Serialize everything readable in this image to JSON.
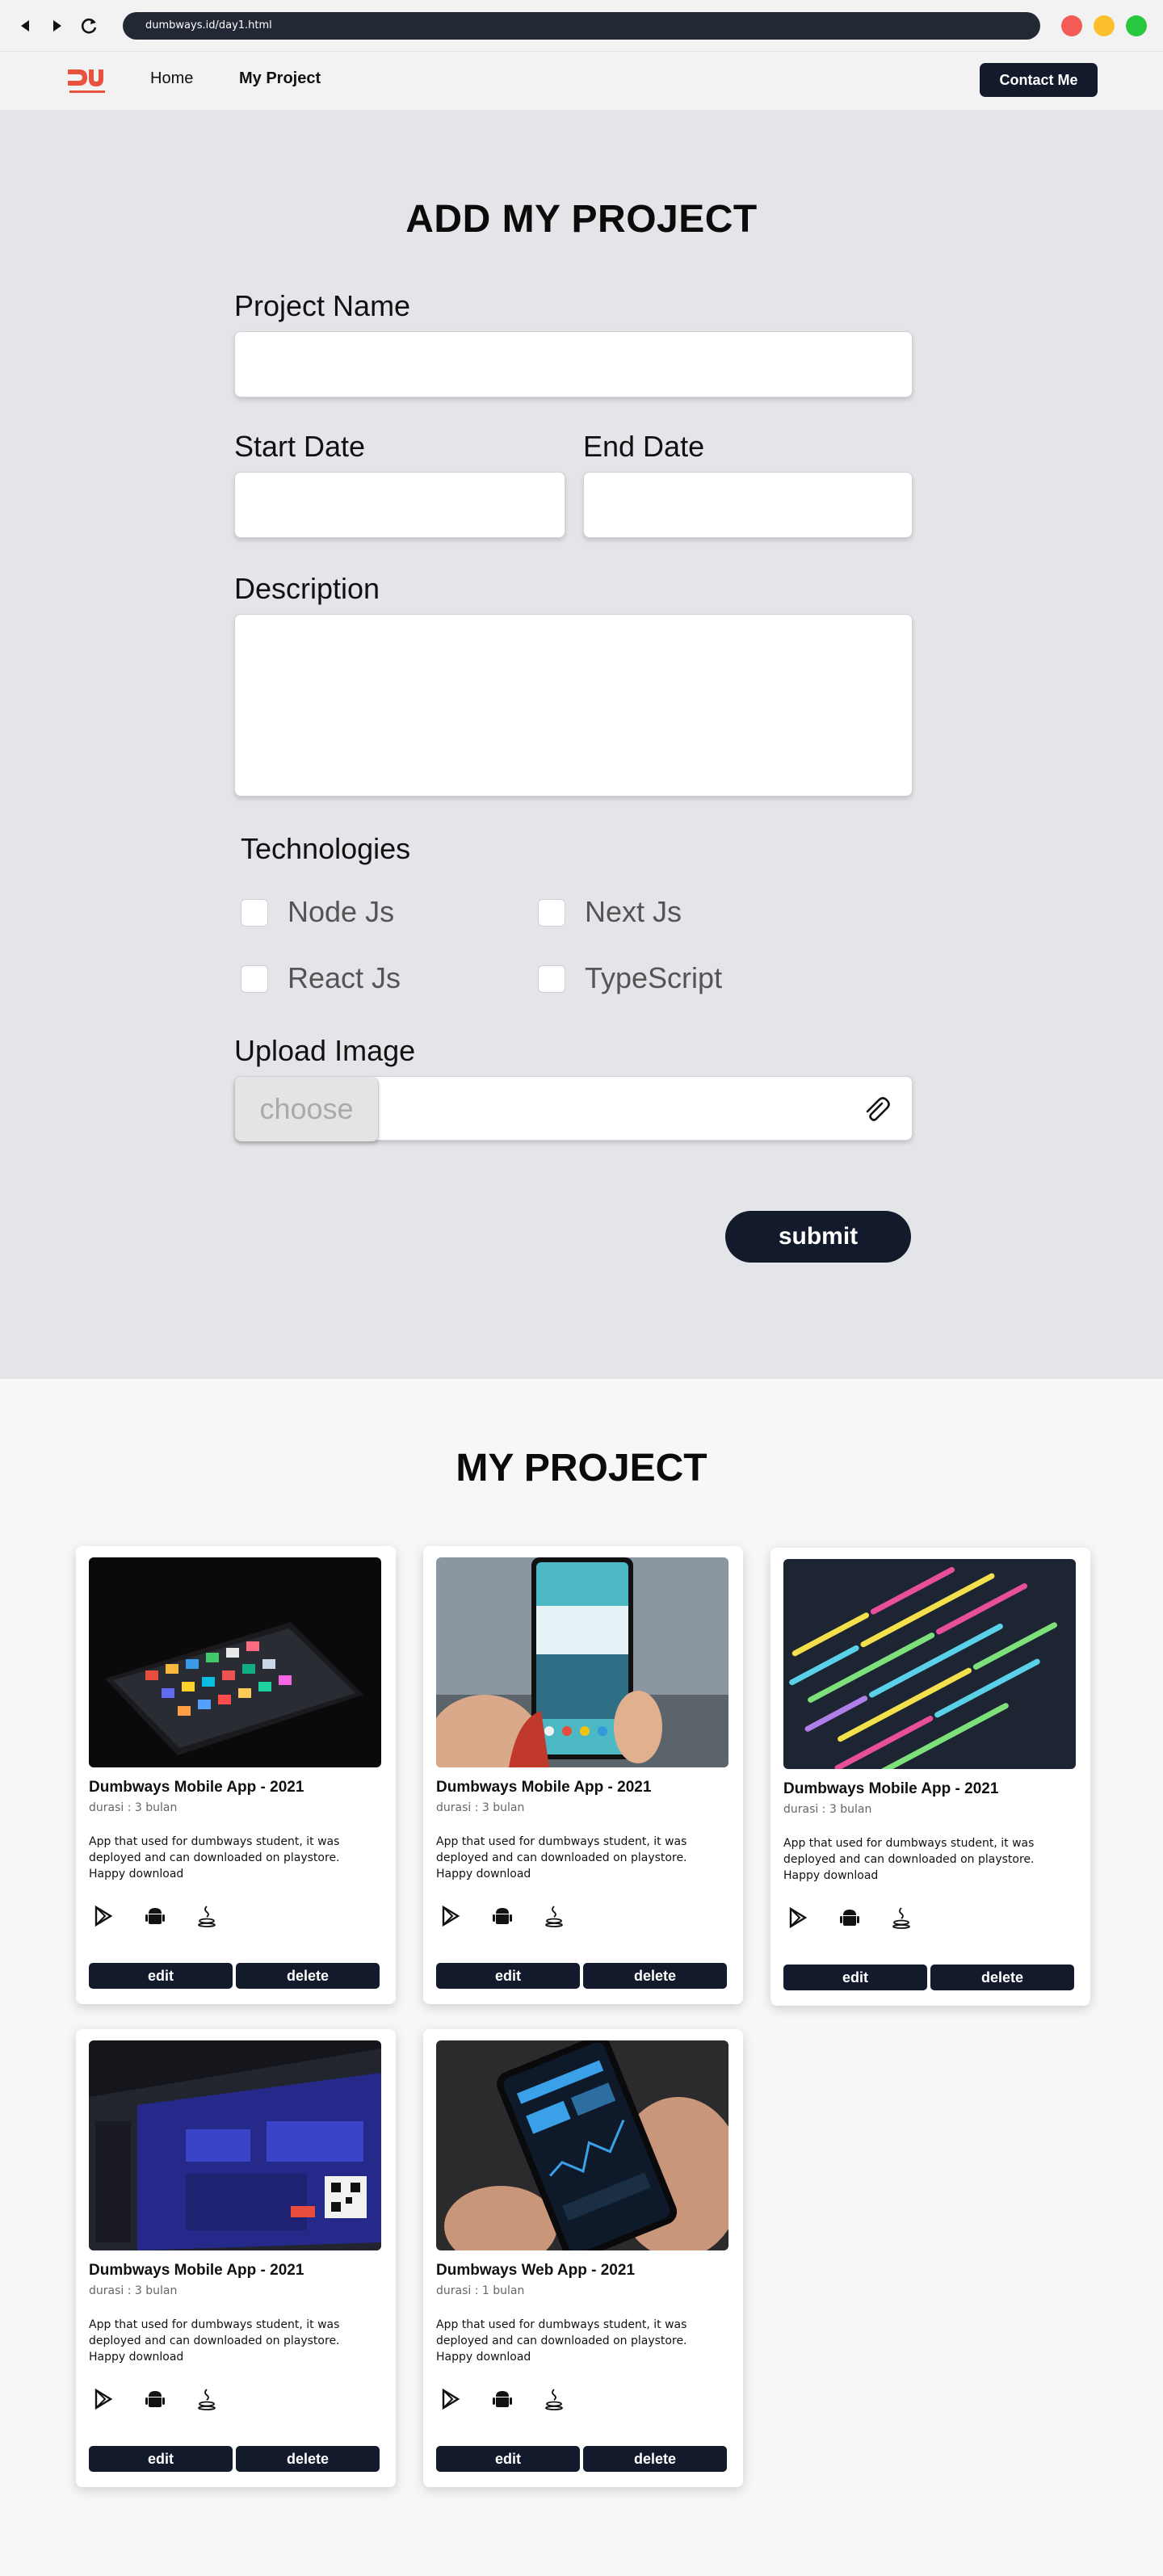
{
  "browser": {
    "url": "dumbways.id/day1.html",
    "dot_colors": [
      "#f25b56",
      "#fbbf2e",
      "#27c840"
    ]
  },
  "nav": {
    "logo_icon": "dumbways-logo",
    "links": [
      {
        "label": "Home"
      },
      {
        "label": "My Project"
      }
    ],
    "contact_label": "Contact Me"
  },
  "form": {
    "title": "ADD MY PROJECT",
    "project_name_label": "Project Name",
    "project_name_value": "",
    "start_date_label": "Start Date",
    "start_date_value": "",
    "end_date_label": "End Date",
    "end_date_value": "",
    "description_label": "Description",
    "description_value": "",
    "technologies_label": "Technologies",
    "technologies": [
      {
        "label": "Node Js",
        "checked": false
      },
      {
        "label": "Next Js",
        "checked": false
      },
      {
        "label": "React Js",
        "checked": false
      },
      {
        "label": "TypeScript",
        "checked": false
      }
    ],
    "upload_label": "Upload Image",
    "choose_label": "choose",
    "attach_icon": "paperclip-icon",
    "submit_label": "submit"
  },
  "projects": {
    "title": "MY PROJECT",
    "edit_label": "edit",
    "delete_label": "delete",
    "tech_icons": [
      "play-store-icon",
      "android-icon",
      "java-icon"
    ],
    "items": [
      {
        "title": "Dumbways Mobile App - 2021",
        "duration": "durasi : 3 bulan",
        "description": "App that used for dumbways student, it was deployed and can downloaded on playstore. Happy download",
        "image": "phone-apps-dark"
      },
      {
        "title": "Dumbways Mobile App - 2021",
        "duration": "durasi : 3 bulan",
        "description": "App that used for dumbways student, it was deployed and can downloaded on playstore. Happy download",
        "image": "phone-in-hand"
      },
      {
        "title": "Dumbways Mobile App - 2021",
        "duration": "durasi : 3 bulan",
        "description": "App that used for dumbways student, it was deployed and can downloaded on playstore. Happy download",
        "image": "code-screen"
      },
      {
        "title": "Dumbways Mobile App - 2021",
        "duration": "durasi : 3 bulan",
        "description": "App that used for dumbways student, it was deployed and can downloaded on playstore. Happy download",
        "image": "crypto-dashboard"
      },
      {
        "title": "Dumbways Web App - 2021",
        "duration": "durasi : 1 bulan",
        "description": "App that used for dumbways student, it was deployed and can downloaded on playstore. Happy download",
        "image": "phone-trading-app"
      }
    ]
  }
}
